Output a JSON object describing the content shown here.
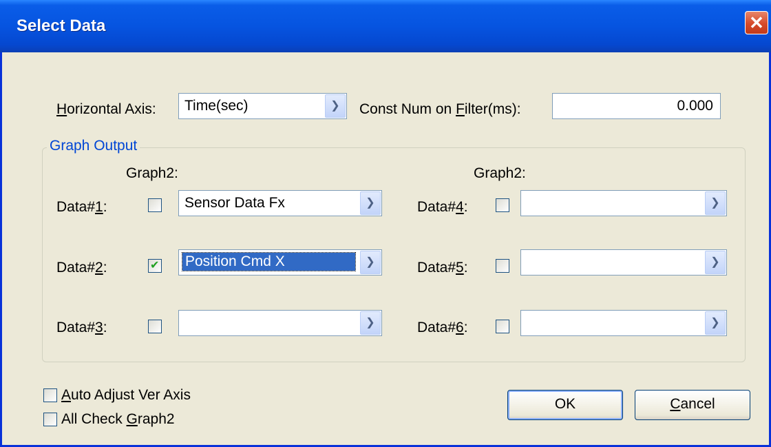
{
  "window": {
    "title": "Select Data",
    "close_glyph": "✕"
  },
  "horizontal_axis": {
    "label_underline": "H",
    "label_rest": "orizontal Axis:",
    "value": "Time(sec)"
  },
  "filter": {
    "label_pre": "Const Num on ",
    "label_underline": "F",
    "label_post": "ilter(ms):",
    "value": "0.000"
  },
  "graph_output": {
    "title": "Graph Output",
    "graph2_header_left": "Graph2:",
    "graph2_header_right": "Graph2:",
    "rows": [
      {
        "label_pre": "Data#",
        "label_key": "1",
        "label_post": ":",
        "checked": false,
        "value": "Sensor Data Fx"
      },
      {
        "label_pre": "Data#",
        "label_key": "2",
        "label_post": ":",
        "checked": true,
        "value": "Position Cmd X"
      },
      {
        "label_pre": "Data#",
        "label_key": "3",
        "label_post": ":",
        "checked": false,
        "value": ""
      },
      {
        "label_pre": "Data#",
        "label_key": "4",
        "label_post": ":",
        "checked": false,
        "value": ""
      },
      {
        "label_pre": "Data#",
        "label_key": "5",
        "label_post": ":",
        "checked": false,
        "value": ""
      },
      {
        "label_pre": "Data#",
        "label_key": "6",
        "label_post": ":",
        "checked": false,
        "value": ""
      }
    ]
  },
  "options": {
    "auto_adjust_underline": "A",
    "auto_adjust_rest": "uto Adjust Ver Axis",
    "auto_adjust_checked": false,
    "all_check_pre": "All Check ",
    "all_check_underline": "G",
    "all_check_post": "raph2",
    "all_check_checked": false
  },
  "buttons": {
    "ok": "OK",
    "cancel_underline": "C",
    "cancel_rest": "ancel"
  },
  "icons": {
    "dropdown": "chevron-down-icon",
    "check": "checkmark-icon"
  }
}
